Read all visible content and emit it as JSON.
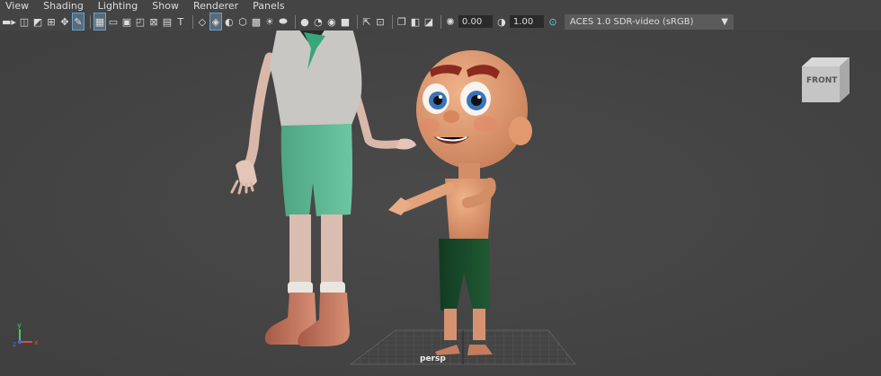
{
  "menubar": {
    "items": [
      "View",
      "Shading",
      "Lighting",
      "Show",
      "Renderer",
      "Panels"
    ]
  },
  "toolbar": {
    "exposure_value": "0.00",
    "gamma_value": "1.00",
    "color_space": "ACES 1.0 SDR-video (sRGB)"
  },
  "viewport": {
    "camera_label": "persp",
    "view_cube_label": "FRONT"
  }
}
